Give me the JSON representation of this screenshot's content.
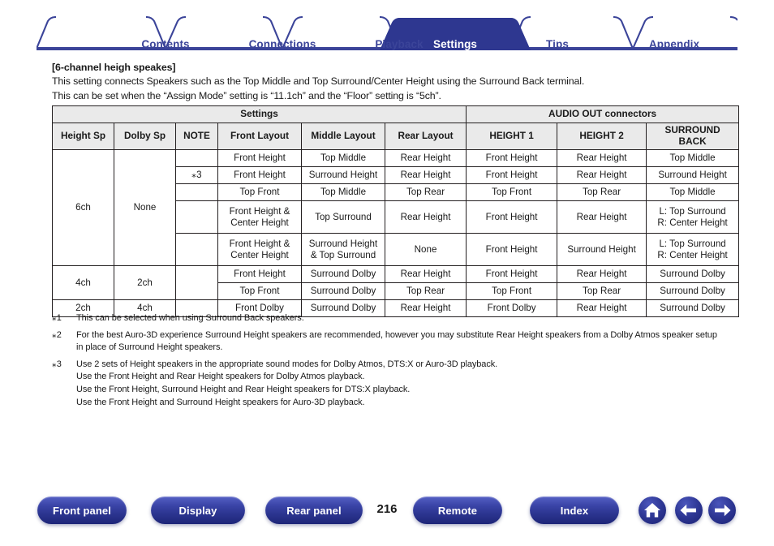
{
  "nav_tabs": [
    {
      "label": "Contents",
      "active": false
    },
    {
      "label": "Connections",
      "active": false
    },
    {
      "label": "Playback",
      "active": false
    },
    {
      "label": "Settings",
      "active": true
    },
    {
      "label": "Tips",
      "active": false
    },
    {
      "label": "Appendix",
      "active": false
    }
  ],
  "content": {
    "heading": "[6-channel heigh speakes]",
    "intro_line1": "This setting connects Speakers such as the Top Middle and Top Surround/Center Height using the Surround Back terminal.",
    "intro_line2": "This can be set when the “Assign Mode” setting is “11.1ch” and the “Floor” setting is “5ch”."
  },
  "table": {
    "group_headers": [
      {
        "label": "Settings",
        "span": 6
      },
      {
        "label": "AUDIO OUT connectors",
        "span": 3
      }
    ],
    "columns": [
      "Height Sp",
      "Dolby Sp",
      "NOTE",
      "Front Layout",
      "Middle Layout",
      "Rear Layout",
      "HEIGHT 1",
      "HEIGHT 2",
      "SURROUND BACK"
    ],
    "column_surround_back_line1": "SURROUND",
    "column_surround_back_line2": "BACK",
    "groups": [
      {
        "height_sp": "6ch",
        "dolby_sp": "None",
        "rows": [
          {
            "note": "",
            "front_layout": "Front Height",
            "middle_layout": "Top Middle",
            "rear_layout": "Rear Height",
            "height1": "Front Height",
            "height2": "Rear Height",
            "surround_back": "Top Middle"
          },
          {
            "note": "⁎3",
            "front_layout": "Front Height",
            "middle_layout": "Surround Height",
            "rear_layout": "Rear Height",
            "height1": "Front Height",
            "height2": "Rear Height",
            "surround_back": "Surround Height"
          },
          {
            "note": "",
            "front_layout": "Top Front",
            "middle_layout": "Top Middle",
            "rear_layout": "Top Rear",
            "height1": "Top Front",
            "height2": "Top Rear",
            "surround_back": "Top Middle"
          },
          {
            "note": "",
            "front_layout_l1": "Front Height &",
            "front_layout_l2": "Center Height",
            "middle_layout": "Top Surround",
            "rear_layout": "Rear Height",
            "height1": "Front Height",
            "height2": "Rear Height",
            "surround_back_l1": "L: Top Surround",
            "surround_back_l2": "R: Center Height"
          },
          {
            "note": "",
            "front_layout_l1": "Front Height &",
            "front_layout_l2": "Center Height",
            "middle_layout_l1": "Surround Height",
            "middle_layout_l2": "& Top Surround",
            "rear_layout": "None",
            "height1": "Front Height",
            "height2": "Surround Height",
            "surround_back_l1": "L: Top Surround",
            "surround_back_l2": "R: Center Height"
          }
        ]
      },
      {
        "height_sp": "4ch",
        "dolby_sp": "2ch",
        "rows": [
          {
            "note": "",
            "front_layout": "Front Height",
            "middle_layout": "Surround Dolby",
            "rear_layout": "Rear Height",
            "height1": "Front Height",
            "height2": "Rear Height",
            "surround_back": "Surround Dolby"
          },
          {
            "note": "",
            "front_layout": "Top Front",
            "middle_layout": "Surround Dolby",
            "rear_layout": "Top Rear",
            "height1": "Top Front",
            "height2": "Top Rear",
            "surround_back": "Surround Dolby"
          }
        ]
      },
      {
        "height_sp": "2ch",
        "dolby_sp": "4ch",
        "rows": [
          {
            "note": "",
            "front_layout": "Front Dolby",
            "middle_layout": "Surround Dolby",
            "rear_layout": "Rear Height",
            "height1": "Front Dolby",
            "height2": "Rear Height",
            "surround_back": "Surround Dolby"
          }
        ]
      }
    ]
  },
  "footnotes": [
    {
      "mark": "⁎1",
      "lines": [
        "This can be selected when using Surround Back speakers."
      ]
    },
    {
      "mark": "⁎2",
      "lines": [
        "For the best Auro-3D experience Surround Height speakers are recommended, however you may substitute Rear Height speakers from a Dolby Atmos speaker setup",
        "in place of Surround Height speakers."
      ]
    },
    {
      "mark": "⁎3",
      "lines": [
        "Use 2 sets of Height speakers in the appropriate sound modes for Dolby Atmos, DTS:X or Auro-3D playback.",
        "Use the Front Height and Rear Height speakers for Dolby Atmos playback.",
        "Use the Front Height, Surround Height and Rear Height speakers for DTS:X playback.",
        "Use the Front Height and Surround Height speakers for Auro-3D playback."
      ]
    }
  ],
  "bottom_nav": {
    "buttons": [
      {
        "label": "Front panel",
        "name": "front-panel-button"
      },
      {
        "label": "Display",
        "name": "display-button"
      },
      {
        "label": "Rear panel",
        "name": "rear-panel-button"
      },
      {
        "label": "Remote",
        "name": "remote-button"
      },
      {
        "label": "Index",
        "name": "index-button"
      }
    ],
    "page_number": "216",
    "icons": [
      "home-icon",
      "back-arrow-icon",
      "forward-arrow-icon"
    ]
  },
  "colors": {
    "brand_blue": "#3b4499",
    "tab_active_bg": "#2e3790",
    "table_header_bg": "#eaeaea",
    "table_border": "#231f20",
    "text": "#1a1a1a"
  }
}
